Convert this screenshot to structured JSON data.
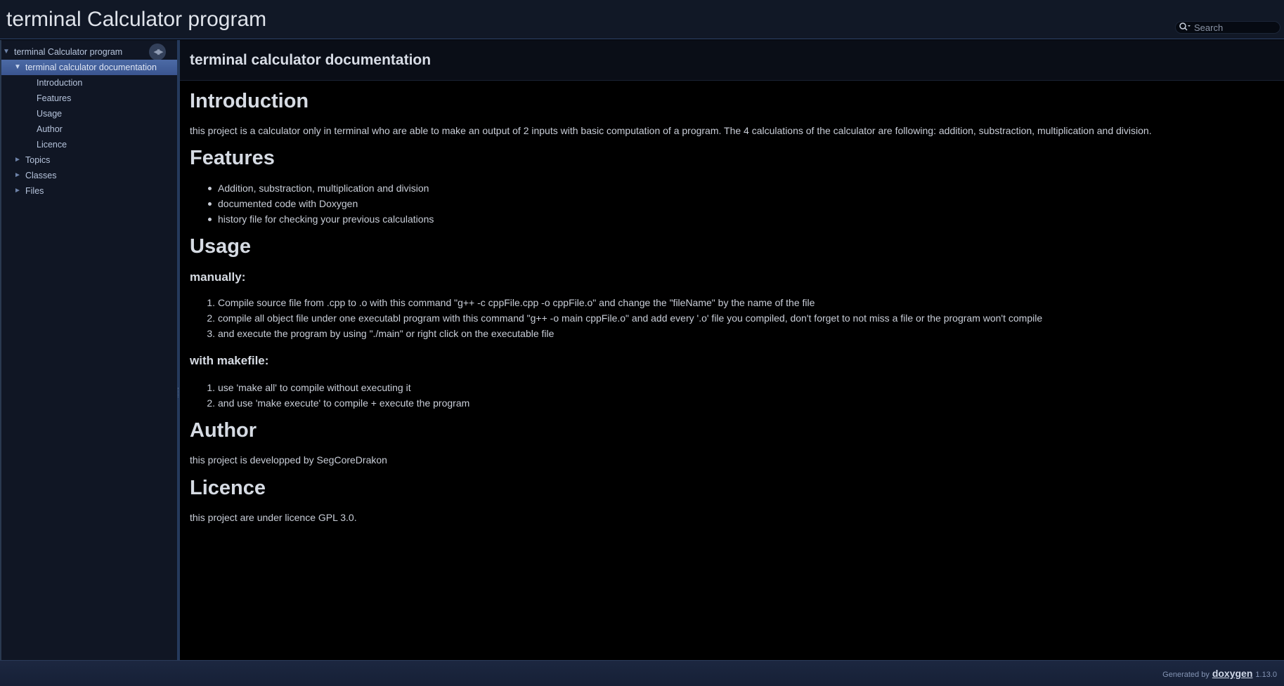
{
  "project": {
    "name": "terminal Calculator program"
  },
  "search": {
    "placeholder": "Search"
  },
  "sidebar": {
    "items": [
      {
        "label": "terminal Calculator program",
        "arrow": "▼"
      },
      {
        "label": "terminal calculator documentation",
        "arrow": "▼",
        "selected": true
      },
      {
        "label": "Introduction"
      },
      {
        "label": "Features"
      },
      {
        "label": "Usage"
      },
      {
        "label": "Author"
      },
      {
        "label": "Licence"
      },
      {
        "label": "Topics",
        "arrow": "►"
      },
      {
        "label": "Classes",
        "arrow": "►"
      },
      {
        "label": "Files",
        "arrow": "►"
      }
    ],
    "sync_icon": "sync-arrows-icon"
  },
  "page": {
    "title": "terminal calculator documentation",
    "introduction": {
      "heading": "Introduction",
      "text": "this project is a calculator only in terminal who are able to make an output of 2 inputs with basic computation of a program. The 4 calculations of the calculator are following: addition, substraction, multiplication and division."
    },
    "features": {
      "heading": "Features",
      "items": [
        "Addition, substraction, multiplication and division",
        "documented code with Doxygen",
        "history file for checking your previous calculations"
      ]
    },
    "usage": {
      "heading": "Usage",
      "manual_heading": "manually:",
      "manual_steps": [
        "Compile source file from .cpp to .o with this command \"g++ -c cppFile.cpp -o cppFile.o\" and change the \"fileName\" by the name of the file",
        "compile all object file under one executabl program with this command \"g++ -o main cppFile.o\" and add every '.o' file you compiled, don't forget to not miss a file or the program won't compile",
        "and execute the program by using \"./main\" or right click on the executable file"
      ],
      "makefile_heading": "with makefile:",
      "makefile_steps": [
        "use 'make all' to compile without executing it",
        "and use 'make execute' to compile + execute the program"
      ]
    },
    "author": {
      "heading": "Author",
      "text": "this project is developped by SegCoreDrakon"
    },
    "licence": {
      "heading": "Licence",
      "text": "this project are under licence GPL 3.0."
    }
  },
  "footer": {
    "generated_by": "Generated by",
    "logo": "doxygen",
    "version": "1.13.0"
  }
}
